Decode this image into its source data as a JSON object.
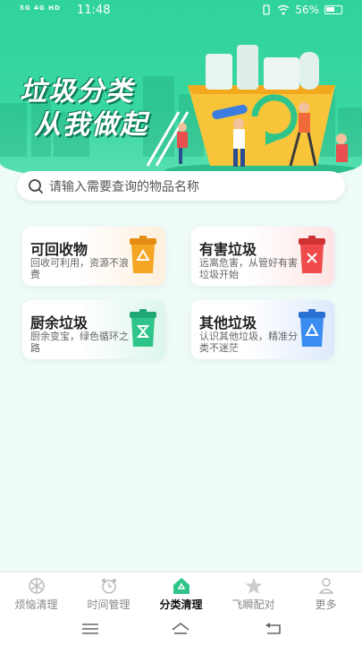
{
  "status": {
    "signal": "5G 4G HD",
    "time": "11:48",
    "battery": "56%"
  },
  "banner": {
    "title_line1": "垃圾分类",
    "title_line2": "从我做起"
  },
  "search": {
    "placeholder": "请输入需要查询的物品名称"
  },
  "categories": [
    {
      "title": "可回收物",
      "desc": "回收可利用，资源不浪费",
      "color": "#f5a623"
    },
    {
      "title": "有害垃圾",
      "desc": "远离危害，从管好有害垃圾开始",
      "color": "#ef4b4b"
    },
    {
      "title": "厨余垃圾",
      "desc": "厨余变宝，绿色循环之路",
      "color": "#2fc58a"
    },
    {
      "title": "其他垃圾",
      "desc": "认识其他垃圾，精准分类不迷茫",
      "color": "#3b8cf0"
    }
  ],
  "tabs": [
    {
      "label": "烦恼清理",
      "icon": "snowflake-icon"
    },
    {
      "label": "时间管理",
      "icon": "alarm-clock-icon"
    },
    {
      "label": "分类清理",
      "icon": "home-icon",
      "active": true
    },
    {
      "label": "飞瞬配对",
      "icon": "star-icon"
    },
    {
      "label": "更多",
      "icon": "person-icon"
    }
  ],
  "colors": {
    "accent": "#2fd39b",
    "active_tab": "#2fc58a"
  }
}
